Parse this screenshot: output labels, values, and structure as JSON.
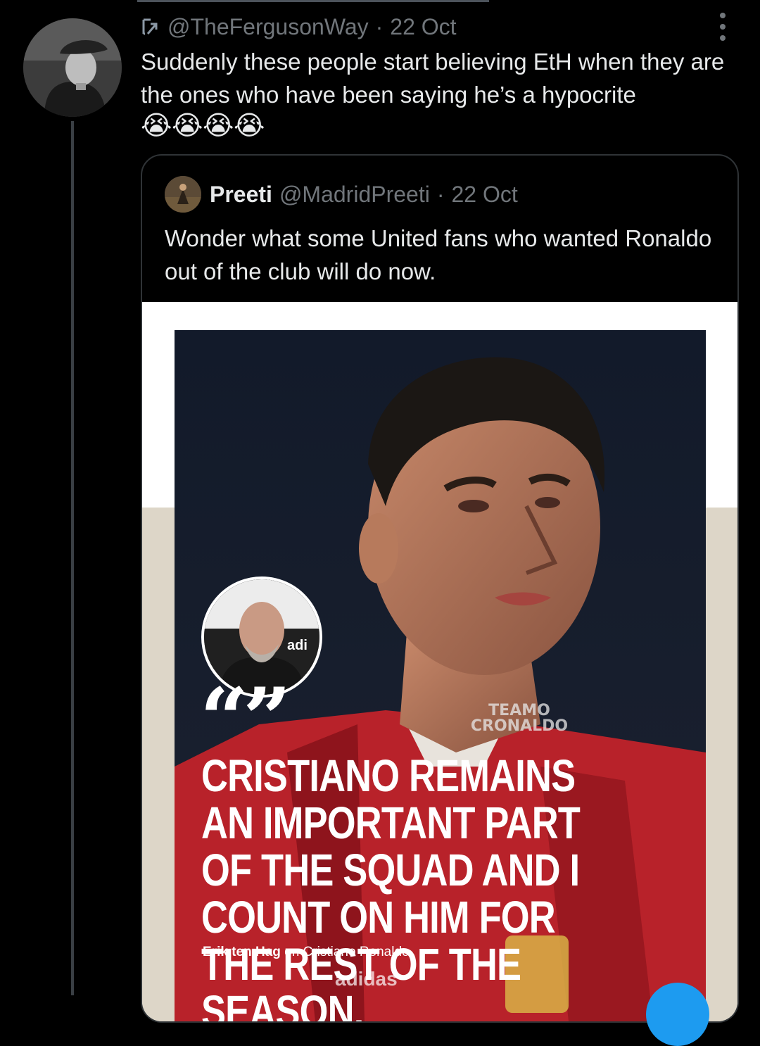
{
  "tweet": {
    "handle": "@TheFergusonWay",
    "separator": "·",
    "date": "22 Oct",
    "text": "Suddenly these people start believing EtH when they are the ones who have been saying he’s a hypocrite",
    "emojis": [
      "😭",
      "😭",
      "😭",
      "😭"
    ]
  },
  "quoted": {
    "name": "Preeti",
    "handle": "@MadridPreeti",
    "separator": "·",
    "date": "22 Oct",
    "text": "Wonder what some United fans who wanted Ronaldo out of the club will do now."
  },
  "media": {
    "quote_marks": "“”",
    "watermark": "TEAMO CRONALDO",
    "headline": "CRISTIANO REMAINS AN IMPORTANT PART OF THE SQUAD AND I COUNT ON HIM FOR THE REST OF THE SEASON.",
    "attribution_name": "Erik ten Hag",
    "attribution_rest": " on Cristiano Ronaldo",
    "jersey_brand": "adidas"
  },
  "colors": {
    "background": "#000000",
    "text_primary": "#e7e9ea",
    "text_secondary": "#71767b",
    "border": "#2f3336",
    "accent": "#1d9bf0"
  }
}
